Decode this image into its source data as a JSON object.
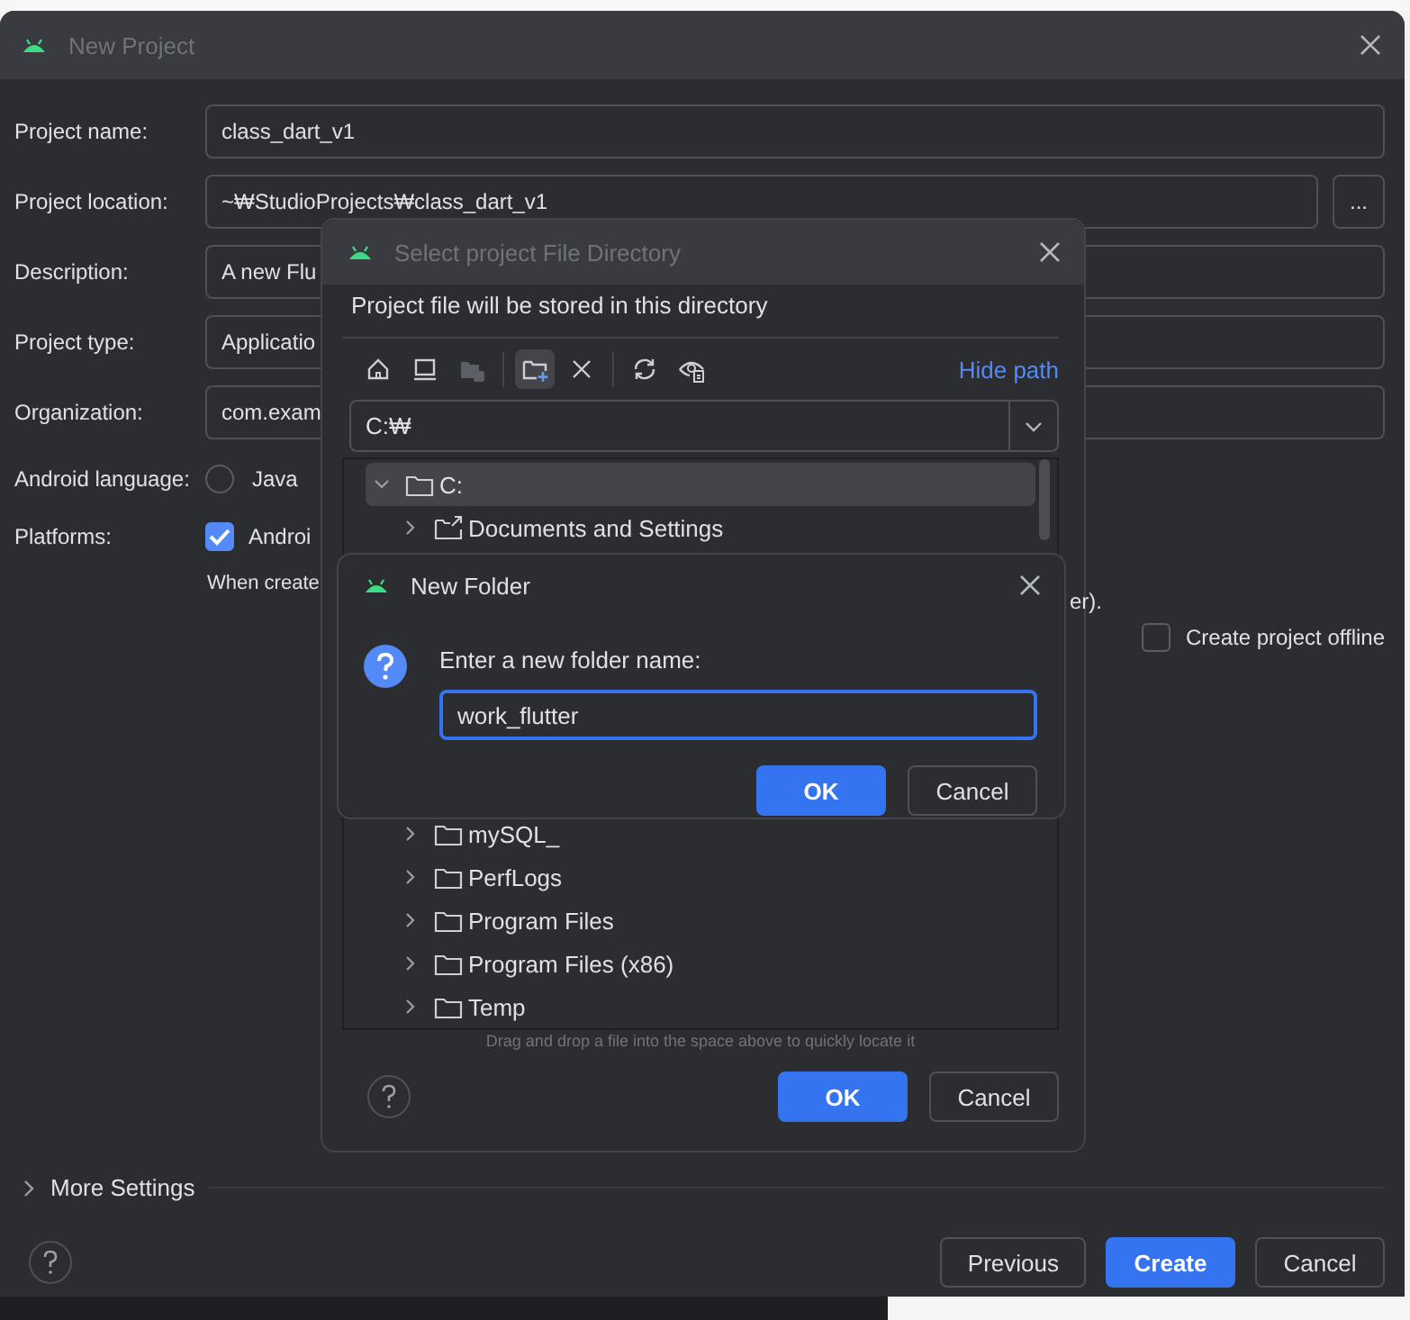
{
  "main_window": {
    "title": "New Project",
    "active": false,
    "fields": [
      {
        "label": "Project name:",
        "value": "class_dart_v1"
      },
      {
        "label": "Project location:",
        "value": "~₩StudioProjects₩class_dart_v1",
        "browse": "..."
      },
      {
        "label": "Description:",
        "value": "A new Flu"
      },
      {
        "label": "Project type:",
        "value": "Applicatio"
      },
      {
        "label": "Organization:",
        "value": "com.exam"
      }
    ],
    "android_language": {
      "label": "Android language:",
      "options": [
        {
          "label": "Java",
          "selected": false
        }
      ]
    },
    "platforms": {
      "label": "Platforms:",
      "options": [
        {
          "label": "Androi",
          "checked": true
        }
      ],
      "note_start": "When create",
      "note_end": "er)."
    },
    "offline": {
      "label": "Create project offline",
      "checked": false
    },
    "more_settings": {
      "label": "More Settings",
      "expanded": false
    },
    "buttons": [
      {
        "label": "Previous",
        "primary": false
      },
      {
        "label": "Create",
        "primary": true
      },
      {
        "label": "Cancel",
        "primary": false
      }
    ]
  },
  "file_dialog": {
    "title": "Select project File Directory",
    "active": false,
    "message": "Project file will be stored in this directory",
    "toolbar": [
      {
        "kind": "home",
        "disabled": false,
        "selected": false
      },
      {
        "kind": "desktop",
        "disabled": false,
        "selected": false
      },
      {
        "kind": "project",
        "disabled": true,
        "selected": false
      },
      {
        "kind": "new-folder",
        "disabled": false,
        "selected": true
      },
      {
        "kind": "delete",
        "disabled": false,
        "selected": false
      },
      {
        "kind": "refresh",
        "disabled": false,
        "selected": false
      },
      {
        "kind": "hidden",
        "disabled": false,
        "selected": false
      }
    ],
    "hide_path": "Hide path",
    "path": "C:₩",
    "tree": [
      {
        "label": "C:",
        "expanded": true,
        "selected": true,
        "children": [
          {
            "label": "Documents and Settings",
            "kind": "link",
            "expanded": false,
            "selected": false
          },
          {
            "label": "mySQL_",
            "kind": "folder",
            "expanded": false,
            "selected": false
          },
          {
            "label": "PerfLogs",
            "kind": "folder",
            "expanded": false,
            "selected": false
          },
          {
            "label": "Program Files",
            "kind": "folder",
            "expanded": false,
            "selected": false
          },
          {
            "label": "Program Files (x86)",
            "kind": "folder",
            "expanded": false,
            "selected": false
          },
          {
            "label": "Temp",
            "kind": "folder",
            "expanded": false,
            "selected": false
          }
        ]
      }
    ],
    "hint": "Drag and drop a file into the space above to quickly locate it",
    "buttons": [
      {
        "label": "OK",
        "primary": true
      },
      {
        "label": "Cancel",
        "primary": false
      }
    ]
  },
  "new_folder_dialog": {
    "title": "New Folder",
    "active": true,
    "prompt": "Enter a new folder name:",
    "value": "work_flutter",
    "buttons": [
      {
        "label": "OK",
        "primary": true
      },
      {
        "label": "Cancel",
        "primary": false
      }
    ]
  }
}
